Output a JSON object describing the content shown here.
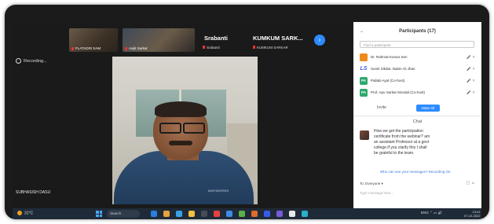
{
  "stage": {
    "thumbnails": [
      {
        "label": "FLATADRI SAM"
      },
      {
        "label": "Avijit Sarkar"
      }
    ],
    "name_tiles": [
      {
        "big": "Srabanti",
        "small": "Srabanti"
      },
      {
        "big": "KUMKUM SARK...",
        "small": "KUMKUM SARKAR"
      }
    ],
    "next_page": "›",
    "recording": "Recording...",
    "speaker_name": "SUBHASISH DASU",
    "speaker_shirt_text": "MATHWORKS"
  },
  "participants_panel": {
    "title": "Participants (17)",
    "collapse_icon": "chevron-down-icon",
    "search_placeholder": "Find a participant",
    "rows": [
      {
        "initials": "",
        "name": "Dr. Rahmat Kumar Sen",
        "status": "🎤 ✕",
        "color": "#f08a1c"
      },
      {
        "initials": "LS",
        "name": "Sumit Sikdar, Nabin Ali Jhan",
        "status": "🎤 ✕",
        "color": "#ffffff"
      },
      {
        "initials": "PA",
        "name": "Pallabi Ayal (Co-host)",
        "status": "🎤 ✕",
        "color": "#2fa86e"
      },
      {
        "initials": "PA",
        "name": "Prof. Apu Sarkar Mondal (Co-host)",
        "status": "🎤 ✕",
        "color": "#2fa86e"
      }
    ],
    "invite_label": "Invite",
    "mute_all_label": "Mute All"
  },
  "chat": {
    "title": "Chat",
    "message_lines": [
      "How we get the participation",
      "certificate from the webinar? am",
      "an assistant Professor at a govt",
      "college.If you clarify this I shall",
      "be grateful to the team."
    ],
    "note": "Who can see your messages? Recording On",
    "to_label": "To: Everyone ▾",
    "tools": "▢ ☺",
    "input_placeholder": "Type message here..."
  },
  "taskbar": {
    "weather": "31°C",
    "search_label": "Search",
    "tray_text": "ENG  ⌃  ▭  🔊",
    "clock_time": "13:01",
    "clock_date": "07-10-2022",
    "apps": [
      "#2a7de1",
      "#e8a33a",
      "#3aa0e8",
      "#f0c040",
      "#444c58",
      "#e84040",
      "#3a8ae8",
      "#5ab04a",
      "#e06a2a",
      "#3a5ae8",
      "#7a5ad8",
      "#e8e8e8",
      "#2ab0c8"
    ]
  }
}
